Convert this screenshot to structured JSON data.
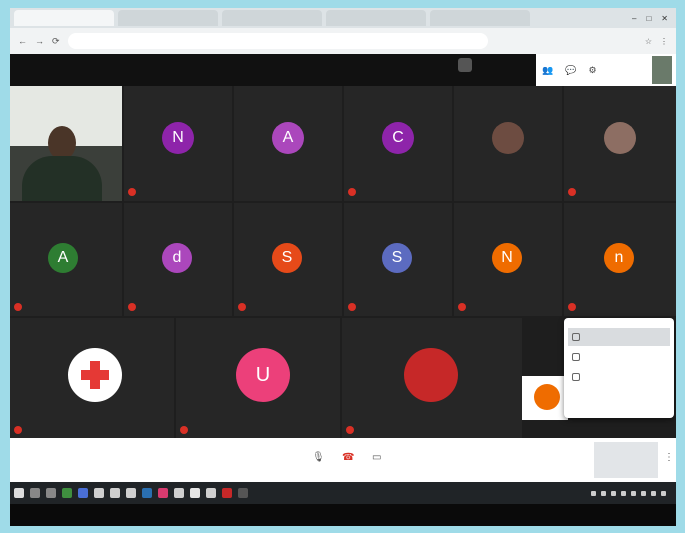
{
  "browser": {
    "tabs": [
      "",
      "",
      "",
      "",
      ""
    ],
    "url": "",
    "window_controls": [
      "–",
      "□",
      "✕"
    ],
    "nav": [
      "←",
      "→",
      "⟳"
    ],
    "addr_icons": [
      "☆",
      "⋮"
    ]
  },
  "meet_header": {
    "info_line1": "",
    "info_line2": "",
    "icons": [
      "people-icon",
      "chat-icon",
      "activities-icon"
    ]
  },
  "participants": [
    {
      "id": "p1",
      "initial": "N",
      "color": "#8e24aa",
      "muted": true
    },
    {
      "id": "p2",
      "initial": "A",
      "color": "#ab47bc",
      "muted": false
    },
    {
      "id": "p3",
      "initial": "C",
      "color": "#8e24aa",
      "muted": true
    },
    {
      "id": "p4",
      "initial": "",
      "color": "#6d4c41",
      "muted": false,
      "photo": true
    },
    {
      "id": "p5",
      "initial": "",
      "color": "#8d6e63",
      "muted": true,
      "photo": true
    },
    {
      "id": "p6",
      "initial": "A",
      "color": "#2e7d32",
      "muted": true
    },
    {
      "id": "p7",
      "initial": "d",
      "color": "#ab47bc",
      "muted": true
    },
    {
      "id": "p8",
      "initial": "S",
      "color": "#e64a19",
      "muted": true
    },
    {
      "id": "p9",
      "initial": "S",
      "color": "#5c6bc0",
      "muted": true
    },
    {
      "id": "p10",
      "initial": "N",
      "color": "#ef6c00",
      "muted": true
    },
    {
      "id": "p11",
      "initial": "n",
      "color": "#ef6c00",
      "muted": true
    },
    {
      "id": "p12",
      "initial": "",
      "color": "#e53935",
      "muted": true,
      "photo": true
    },
    {
      "id": "p13",
      "initial": "U",
      "color": "#ec407a",
      "muted": true
    },
    {
      "id": "p14",
      "initial": "",
      "color": "#c62828",
      "muted": true,
      "photo": true
    }
  ],
  "popup": {
    "title": "",
    "items": [
      "",
      "",
      ""
    ]
  },
  "controls": {
    "meeting_details": "",
    "mic_icon": "🎤",
    "hangup_icon": "☎",
    "camera_icon": "▭",
    "captions_label": "",
    "present_label": "",
    "more_icon": "⋮"
  },
  "colors": {
    "mute_red": "#d93025",
    "grid_bg": "#1e1e1e",
    "outer_bg": "#9fdbe8"
  }
}
